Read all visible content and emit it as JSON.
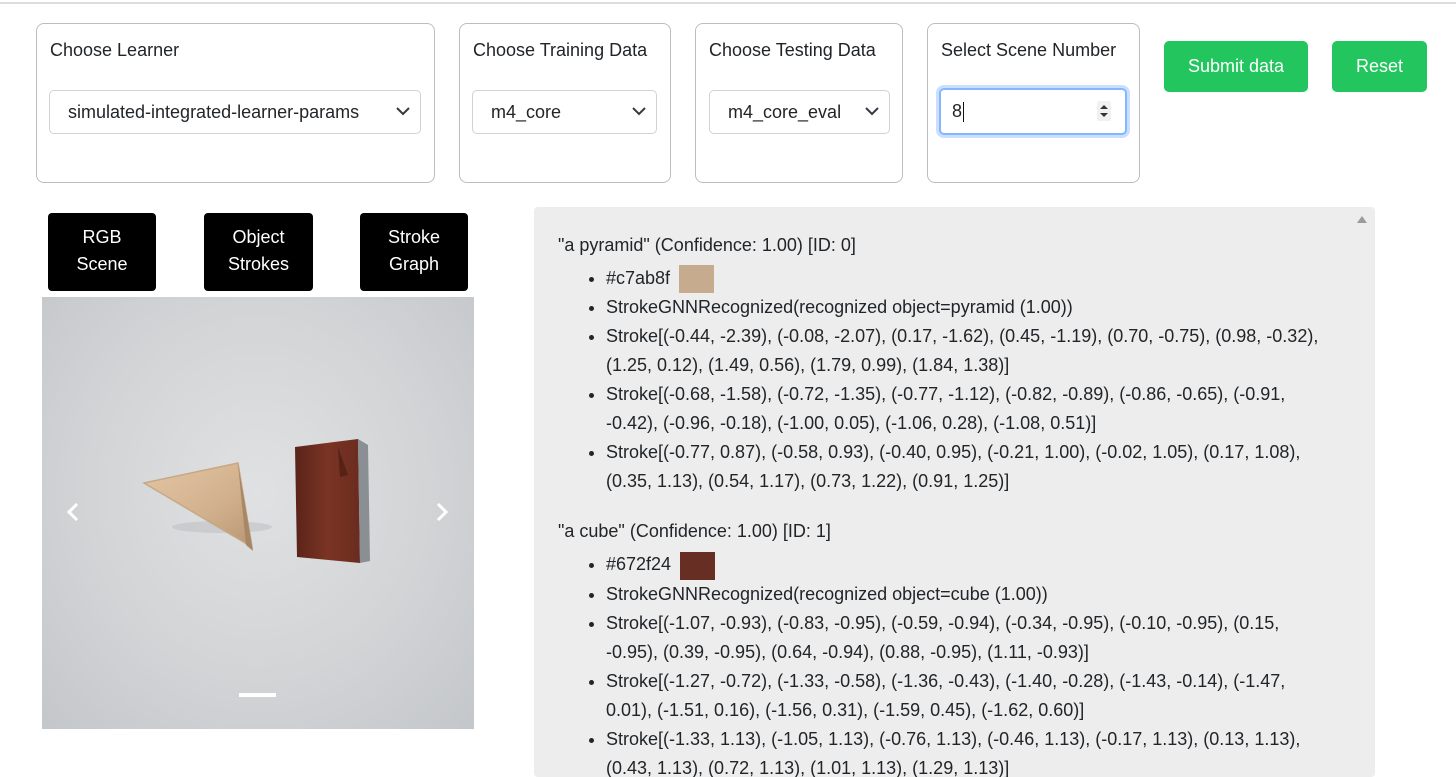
{
  "controls": {
    "learner": {
      "title": "Choose Learner",
      "value": "simulated-integrated-learner-params"
    },
    "training": {
      "title": "Choose Training Data",
      "value": "m4_core"
    },
    "testing": {
      "title": "Choose Testing Data",
      "value": "m4_core_eval"
    },
    "scene": {
      "title": "Select Scene Number",
      "value": "8"
    },
    "submit_label": "Submit data",
    "reset_label": "Reset"
  },
  "views": {
    "rgb": {
      "line1": "RGB",
      "line2": "Scene"
    },
    "strokes": {
      "line1": "Object",
      "line2": "Strokes"
    },
    "graph": {
      "line1": "Stroke",
      "line2": "Graph"
    }
  },
  "colors": {
    "green": "#22c55e",
    "panel_bg": "#ededed"
  },
  "objects": [
    {
      "title": "\"a pyramid\" (Confidence: 1.00) [ID: 0]",
      "color": "#c7ab8f",
      "recognized": "StrokeGNNRecognized(recognized object=pyramid (1.00))",
      "strokes": [
        "Stroke[(-0.44, -2.39), (-0.08, -2.07), (0.17, -1.62), (0.45, -1.19), (0.70, -0.75), (0.98, -0.32), (1.25, 0.12), (1.49, 0.56), (1.79, 0.99), (1.84, 1.38)]",
        "Stroke[(-0.68, -1.58), (-0.72, -1.35), (-0.77, -1.12), (-0.82, -0.89), (-0.86, -0.65), (-0.91, -0.42), (-0.96, -0.18), (-1.00, 0.05), (-1.06, 0.28), (-1.08, 0.51)]",
        "Stroke[(-0.77, 0.87), (-0.58, 0.93), (-0.40, 0.95), (-0.21, 1.00), (-0.02, 1.05), (0.17, 1.08), (0.35, 1.13), (0.54, 1.17), (0.73, 1.22), (0.91, 1.25)]"
      ]
    },
    {
      "title": "\"a cube\" (Confidence: 1.00) [ID: 1]",
      "color": "#672f24",
      "recognized": "StrokeGNNRecognized(recognized object=cube (1.00))",
      "strokes": [
        "Stroke[(-1.07, -0.93), (-0.83, -0.95), (-0.59, -0.94), (-0.34, -0.95), (-0.10, -0.95), (0.15, -0.95), (0.39, -0.95), (0.64, -0.94), (0.88, -0.95), (1.11, -0.93)]",
        "Stroke[(-1.27, -0.72), (-1.33, -0.58), (-1.36, -0.43), (-1.40, -0.28), (-1.43, -0.14), (-1.47, 0.01), (-1.51, 0.16), (-1.56, 0.31), (-1.59, 0.45), (-1.62, 0.60)]",
        "Stroke[(-1.33, 1.13), (-1.05, 1.13), (-0.76, 1.13), (-0.46, 1.13), (-0.17, 1.13), (0.13, 1.13), (0.43, 1.13), (0.72, 1.13), (1.01, 1.13), (1.29, 1.13)]"
      ]
    }
  ]
}
